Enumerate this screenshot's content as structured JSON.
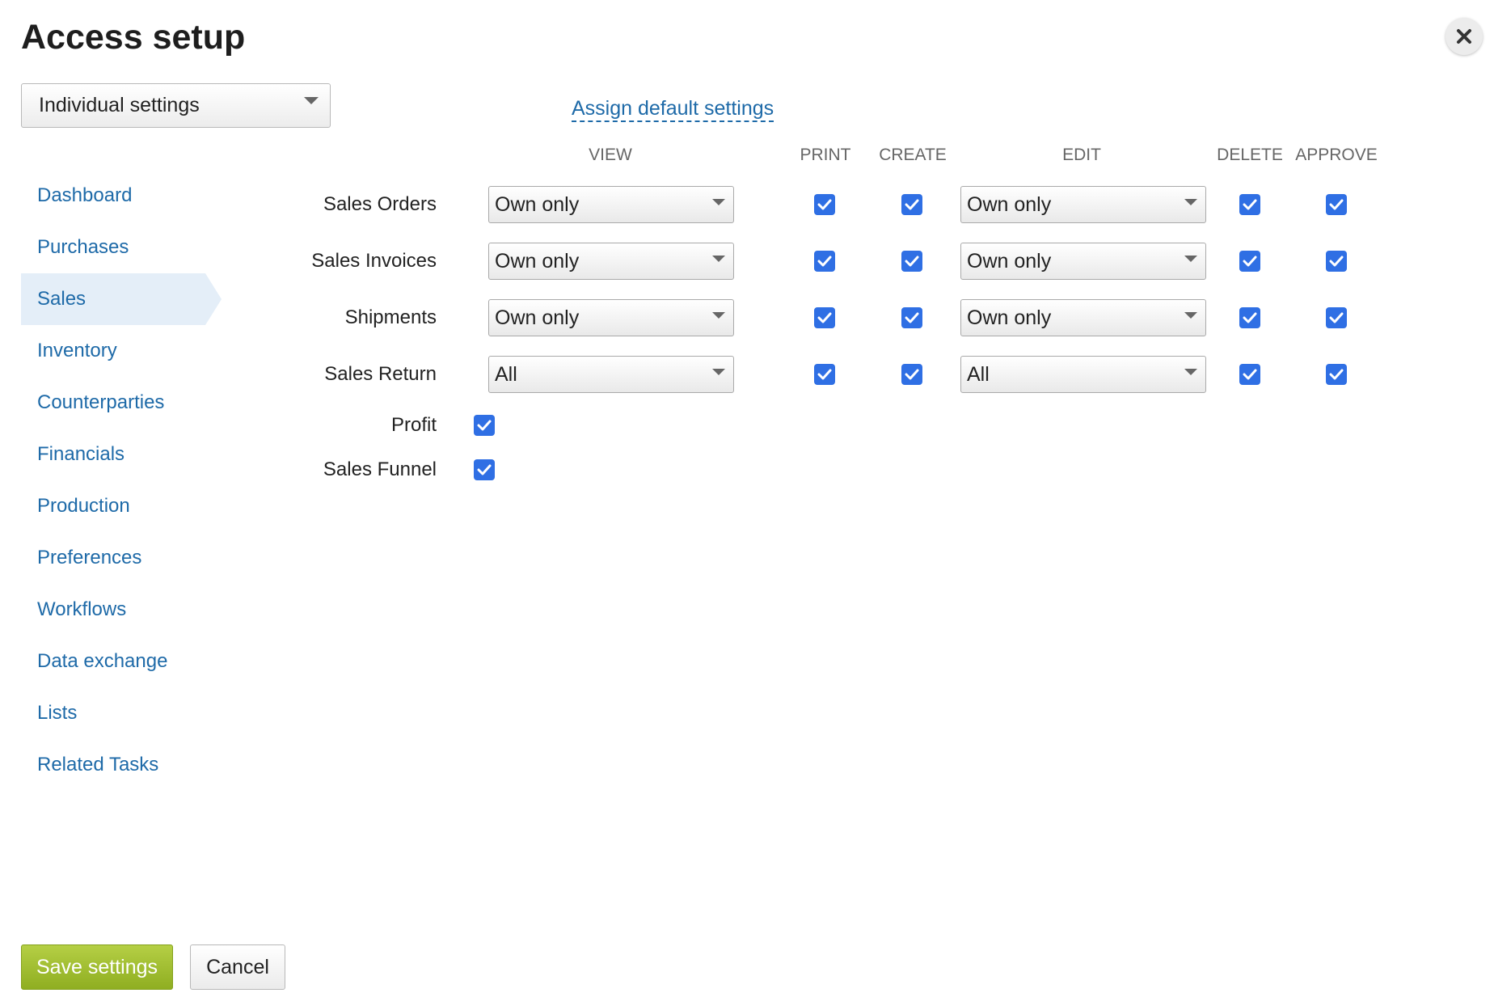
{
  "title": "Access setup",
  "mode_select": {
    "value": "Individual settings"
  },
  "assign_link": "Assign default settings",
  "sidebar": {
    "items": [
      {
        "label": "Dashboard"
      },
      {
        "label": "Purchases"
      },
      {
        "label": "Sales",
        "active": true
      },
      {
        "label": "Inventory"
      },
      {
        "label": "Counterparties"
      },
      {
        "label": "Financials"
      },
      {
        "label": "Production"
      },
      {
        "label": "Preferences"
      },
      {
        "label": "Workflows"
      },
      {
        "label": "Data exchange"
      },
      {
        "label": "Lists"
      },
      {
        "label": "Related Tasks"
      }
    ]
  },
  "columns": {
    "view": "VIEW",
    "print": "PRINT",
    "create": "CREATE",
    "edit": "EDIT",
    "delete": "DELETE",
    "approve": "APPROVE"
  },
  "rows": [
    {
      "label": "Sales Orders",
      "view": "Own only",
      "print": true,
      "create": true,
      "edit": "Own only",
      "delete": true,
      "approve": true
    },
    {
      "label": "Sales Invoices",
      "view": "Own only",
      "print": true,
      "create": true,
      "edit": "Own only",
      "delete": true,
      "approve": true
    },
    {
      "label": "Shipments",
      "view": "Own only",
      "print": true,
      "create": true,
      "edit": "Own only",
      "delete": true,
      "approve": true
    },
    {
      "label": "Sales Return",
      "view": "All",
      "print": true,
      "create": true,
      "edit": "All",
      "delete": true,
      "approve": true
    }
  ],
  "extra_rows": [
    {
      "label": "Profit",
      "checked": true
    },
    {
      "label": "Sales Funnel",
      "checked": true
    }
  ],
  "buttons": {
    "save": "Save settings",
    "cancel": "Cancel"
  },
  "colors": {
    "link": "#1e6aa8",
    "checkbox": "#2f6fe4",
    "save_button": "#9dbb2c",
    "active_nav": "#e4eef8"
  },
  "icons": {
    "close": "close-icon",
    "caret": "chevron-down-icon",
    "check": "check-icon"
  }
}
